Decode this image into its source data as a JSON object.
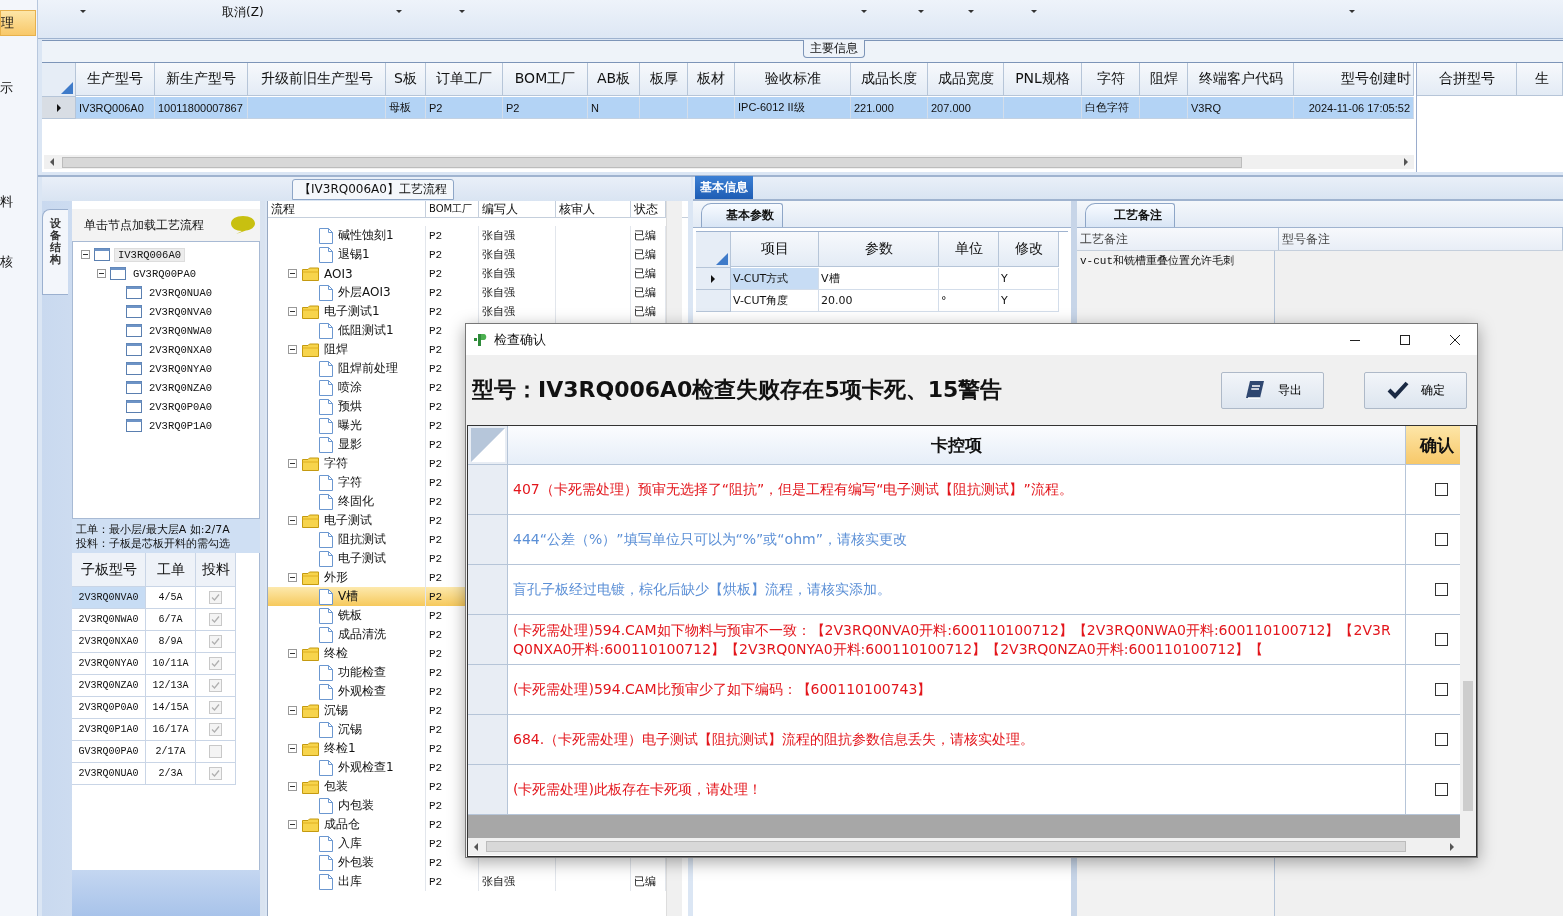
{
  "side_nav": [
    {
      "label": "理",
      "selected": true
    },
    {
      "label": "示",
      "selected": false
    },
    {
      "label": "料",
      "selected": false
    },
    {
      "label": "核",
      "selected": false
    }
  ],
  "toolbar": {
    "cancel_label": "取消(Z)"
  },
  "main_info": {
    "title": "主要信息",
    "columns": [
      "生产型号",
      "新生产型号",
      "升级前旧生产型号",
      "S板",
      "订单工厂",
      "BOM工厂",
      "AB板",
      "板厚",
      "板材",
      "验收标准",
      "成品长度",
      "成品宽度",
      "PNL规格",
      "字符",
      "阻焊",
      "终端客户代码",
      "型号创建时"
    ],
    "rows": [
      {
        "selected": true,
        "cells": [
          "IV3RQ006A0",
          "10011800007867",
          null,
          "母板",
          "P2",
          "P2",
          "N",
          null,
          null,
          "IPC-6012 II级",
          "221.000",
          "207.000",
          null,
          "白色字符",
          null,
          "V3RQ",
          "2024-11-06 17:05:52"
        ]
      }
    ],
    "side_columns": [
      "合拼型号",
      "生"
    ]
  },
  "structure": {
    "tab": "设备结构",
    "hint": "单击节点加载工艺流程",
    "tree": [
      {
        "label": "IV3RQ006A0",
        "selected": true,
        "expanded": true,
        "children": [
          {
            "label": "GV3RQ00PA0",
            "selected": false,
            "expanded": true,
            "children": [
              {
                "label": "2V3RQ0NUA0",
                "selected": false
              },
              {
                "label": "2V3RQ0NVA0",
                "selected": false
              },
              {
                "label": "2V3RQ0NWA0",
                "selected": false
              },
              {
                "label": "2V3RQ0NXA0",
                "selected": false
              },
              {
                "label": "2V3RQ0NYA0",
                "selected": false
              },
              {
                "label": "2V3RQ0NZA0",
                "selected": false
              },
              {
                "label": "2V3RQ0P0A0",
                "selected": false
              },
              {
                "label": "2V3RQ0P1A0",
                "selected": false
              }
            ]
          }
        ]
      }
    ],
    "note": [
      "工单：最小层/最大层A 如:2/7A",
      "投料：子板是芯板开料的需勾选"
    ],
    "columns": [
      "子板型号",
      "工单",
      "投料"
    ],
    "rows": [
      {
        "model": "2V3RQ0NVA0",
        "order": "4/5A",
        "checked": true,
        "selected": true
      },
      {
        "model": "2V3RQ0NWA0",
        "order": "6/7A",
        "checked": true,
        "selected": false
      },
      {
        "model": "2V3RQ0NXA0",
        "order": "8/9A",
        "checked": true,
        "selected": false
      },
      {
        "model": "2V3RQ0NYA0",
        "order": "10/11A",
        "checked": true,
        "selected": false
      },
      {
        "model": "2V3RQ0NZA0",
        "order": "12/13A",
        "checked": true,
        "selected": false
      },
      {
        "model": "2V3RQ0P0A0",
        "order": "14/15A",
        "checked": true,
        "selected": false
      },
      {
        "model": "2V3RQ0P1A0",
        "order": "16/17A",
        "checked": true,
        "selected": false
      },
      {
        "model": "GV3RQ00PA0",
        "order": "2/17A",
        "checked": false,
        "selected": false
      },
      {
        "model": "2V3RQ0NUA0",
        "order": "2/3A",
        "checked": true,
        "selected": false
      }
    ]
  },
  "process": {
    "title": "【IV3RQ006A0】工艺流程",
    "columns": [
      "流程",
      "BOM工厂",
      "编写人",
      "核审人",
      "状态"
    ],
    "nodes": [
      {
        "children": [
          {
            "label": "碱性蚀刻1",
            "bom": "P2",
            "writer": "张自强",
            "status": "已编",
            "selected": false
          },
          {
            "label": "退锡1",
            "bom": "P2",
            "writer": "张自强",
            "status": "已编",
            "selected": false
          }
        ]
      },
      {
        "label": "AOI3",
        "bom": "P2",
        "writer": "张自强",
        "status": "已编",
        "selected": false,
        "expanded": true,
        "children": [
          {
            "label": "外层AOI3",
            "bom": "P2",
            "writer": "张自强",
            "status": "已编",
            "selected": false
          }
        ]
      },
      {
        "label": "电子测试1",
        "bom": "P2",
        "writer": "张自强",
        "status": "已编",
        "selected": false,
        "expanded": true,
        "children": [
          {
            "label": "低阻测试1",
            "bom": "P2",
            "selected": false
          }
        ]
      },
      {
        "label": "阻焊",
        "bom": "P2",
        "selected": false,
        "expanded": true,
        "children": [
          {
            "label": "阻焊前处理",
            "bom": "P2",
            "selected": false
          },
          {
            "label": "喷涂",
            "bom": "P2",
            "selected": false
          },
          {
            "label": "预烘",
            "bom": "P2",
            "selected": false
          },
          {
            "label": "曝光",
            "bom": "P2",
            "selected": false
          },
          {
            "label": "显影",
            "bom": "P2",
            "selected": false
          }
        ]
      },
      {
        "label": "字符",
        "bom": "P2",
        "selected": false,
        "expanded": true,
        "children": [
          {
            "label": "字符",
            "bom": "P2",
            "selected": false
          },
          {
            "label": "终固化",
            "bom": "P2",
            "selected": false
          }
        ]
      },
      {
        "label": "电子测试",
        "bom": "P2",
        "selected": false,
        "expanded": true,
        "children": [
          {
            "label": "阻抗测试",
            "bom": "P2",
            "selected": false
          },
          {
            "label": "电子测试",
            "bom": "P2",
            "selected": false
          }
        ]
      },
      {
        "label": "外形",
        "bom": "P2",
        "selected": false,
        "expanded": true,
        "children": [
          {
            "label": "V槽",
            "bom": "P2",
            "selected": true
          },
          {
            "label": "铣板",
            "bom": "P2",
            "selected": false
          },
          {
            "label": "成品清洗",
            "bom": "P2",
            "selected": false
          }
        ]
      },
      {
        "label": "终检",
        "bom": "P2",
        "selected": false,
        "expanded": true,
        "children": [
          {
            "label": "功能检查",
            "bom": "P2",
            "selected": false
          },
          {
            "label": "外观检查",
            "bom": "P2",
            "selected": false
          }
        ]
      },
      {
        "label": "沉锡",
        "bom": "P2",
        "selected": false,
        "expanded": true,
        "children": [
          {
            "label": "沉锡",
            "bom": "P2",
            "selected": false
          }
        ]
      },
      {
        "label": "终检1",
        "bom": "P2",
        "selected": false,
        "expanded": true,
        "children": [
          {
            "label": "外观检查1",
            "bom": "P2",
            "selected": false
          }
        ]
      },
      {
        "label": "包装",
        "bom": "P2",
        "selected": false,
        "expanded": true,
        "children": [
          {
            "label": "内包装",
            "bom": "P2",
            "selected": false
          }
        ]
      },
      {
        "label": "成品仓",
        "bom": "P2",
        "selected": false,
        "expanded": true,
        "children": [
          {
            "label": "入库",
            "bom": "P2",
            "selected": false
          },
          {
            "label": "外包装",
            "bom": "P2",
            "selected": false
          },
          {
            "label": "出库",
            "bom": "P2",
            "writer": "张自强",
            "status": "已编",
            "selected": false
          }
        ]
      }
    ]
  },
  "info": {
    "tab": "基本信息",
    "params_tab": "基本参数",
    "params_columns": [
      "项目",
      "参数",
      "单位",
      "修改"
    ],
    "params": [
      {
        "item": "V-CUT方式",
        "value": "V槽",
        "edit": "Y",
        "selected": true
      },
      {
        "item": "V-CUT角度",
        "value": "20.00",
        "unit": "°",
        "edit": "Y",
        "selected": false
      }
    ],
    "notes_tab": "工艺备注",
    "notes_columns": [
      "工艺备注",
      "型号备注"
    ],
    "notes": "v-cut和铣槽重叠位置允许毛刺"
  },
  "dialog": {
    "title": "检查确认",
    "heading": "型号：IV3RQ006A0检查失败存在5项卡死、15警告",
    "export_label": "导出",
    "confirm_label": "确定",
    "columns": [
      "卡控项",
      "确认"
    ],
    "rows": [
      {
        "text": "407（卡死需处理）预审无选择了“阻抗”，但是工程有编写“电子测试【阻抗测试】”流程。",
        "color": "#e3161c",
        "checked": false
      },
      {
        "text": "444“公差（%）”填写单位只可以为“%”或“ohm”，请核实更改",
        "color": "#5b8fd6",
        "checked": false
      },
      {
        "text": "盲孔子板经过电镀，棕化后缺少【烘板】流程，请核实添加。",
        "color": "#5b8fd6",
        "checked": false
      },
      {
        "text": "(卡死需处理)594.CAM如下物料与预审不一致：【2V3RQ0NVA0开料:600110100712】【2V3RQ0NWA0开料:600110100712】【2V3RQ0NXA0开料:600110100712】【2V3RQ0NYA0开料:600110100712】【2V3RQ0NZA0开料:600110100712】【",
        "color": "#e3161c",
        "checked": false
      },
      {
        "text": "(卡死需处理)594.CAM比预审少了如下编码：【600110100743】",
        "color": "#e3161c",
        "checked": false
      },
      {
        "text": "684.（卡死需处理）电子测试【阻抗测试】流程的阻抗参数信息丢失，请核实处理。",
        "color": "#e3161c",
        "checked": false
      },
      {
        "text": "(卡死需处理)此板存在卡死项，请处理！",
        "color": "#e3161c",
        "checked": false
      }
    ]
  }
}
